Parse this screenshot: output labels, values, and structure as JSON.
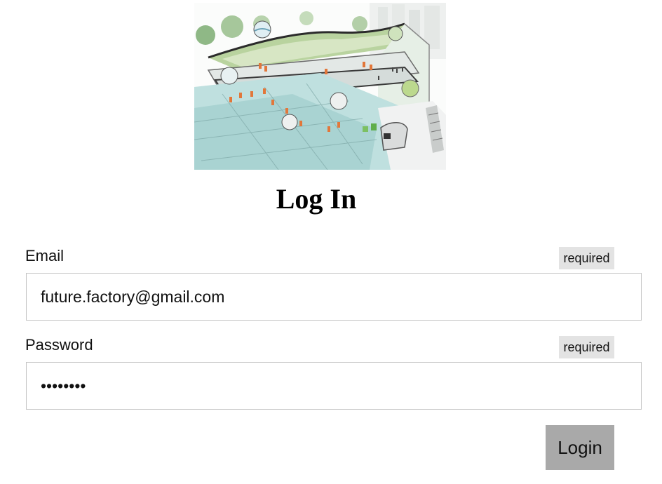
{
  "page": {
    "title": "Log In"
  },
  "hero": {
    "icon": "factory-illustration"
  },
  "form": {
    "email": {
      "label": "Email",
      "badge": "required",
      "value": "future.factory@gmail.com"
    },
    "password": {
      "label": "Password",
      "badge": "required",
      "value": "••••••••"
    },
    "submit_label": "Login"
  },
  "colors": {
    "badge_bg": "#e3e3e3",
    "button_bg": "#a9a9a9",
    "field_border": "#c4c4c4"
  }
}
